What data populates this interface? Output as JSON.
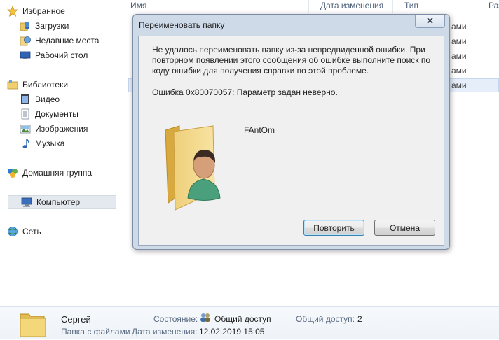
{
  "nav": {
    "favorites": "Избранное",
    "items_fav": [
      "Загрузки",
      "Недавние места",
      "Рабочий стол"
    ],
    "libraries": "Библиотеки",
    "items_lib": [
      "Видео",
      "Документы",
      "Изображения",
      "Музыка"
    ],
    "homegroup": "Домашняя группа",
    "computer": "Компьютер",
    "network": "Сеть"
  },
  "columns": {
    "name": "Имя",
    "date": "Дата изменения",
    "type": "Тип",
    "size": "Разм"
  },
  "background_rows": [
    "ами",
    "ами",
    "ами",
    "ами",
    "ами"
  ],
  "dialog": {
    "title": "Переименовать папку",
    "message": "Не удалось переименовать папку из-за непредвиденной ошибки. При повторном появлении этого сообщения об ошибке выполните поиск по коду ошибки для получения справки по этой проблеме.",
    "error": "Ошибка 0x80070057: Параметр задан неверно.",
    "folder_name": "FAntOm",
    "retry_label": "Повторить",
    "cancel_label": "Отмена"
  },
  "details": {
    "name": "Сергей",
    "kind": "Папка с файлами",
    "state_label": "Состояние:",
    "state_value": "Общий доступ",
    "shared_label": "Общий доступ:",
    "shared_value": "2",
    "modified_label": "Дата изменения:",
    "modified_value": "12.02.2019 15:05"
  }
}
